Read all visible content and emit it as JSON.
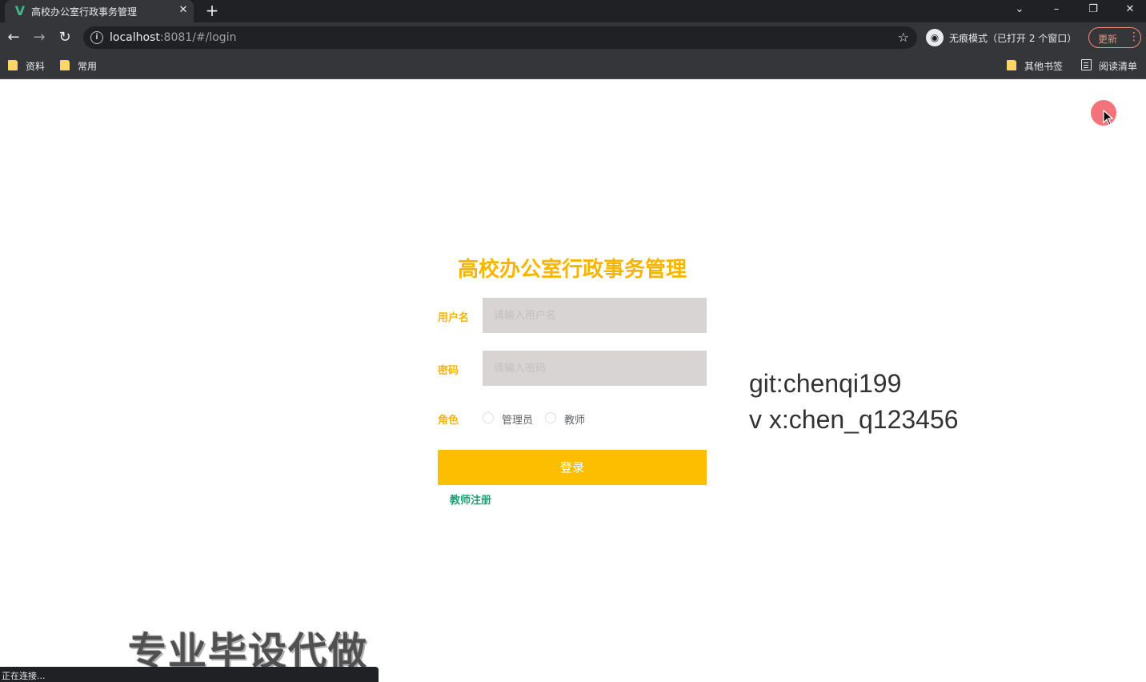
{
  "browser": {
    "tab_title": "高校办公室行政事务管理",
    "tab_favicon": "vue-logo-icon",
    "tab_close": "✕",
    "new_tab": "+",
    "url_host": "localhost",
    "url_rest": ":8081/#/login",
    "incognito_label": "无痕模式（已打开 2 个窗口）",
    "update_label": "更新",
    "bookmarks": [
      {
        "label": "资料",
        "icon": "folder-icon"
      },
      {
        "label": "常用",
        "icon": "folder-icon"
      },
      {
        "label": "其他书签",
        "icon": "folder-icon"
      },
      {
        "label": "阅读清单",
        "icon": "reading-list-icon"
      }
    ],
    "status_text": "正在连接..."
  },
  "login": {
    "title": "高校办公室行政事务管理",
    "username_label": "用户名",
    "username_placeholder": "请输入用户名",
    "password_label": "密码",
    "password_placeholder": "请输入密码",
    "role_label": "角色",
    "roles": [
      "管理员",
      "教师"
    ],
    "submit_label": "登录",
    "register_link": "教师注册"
  },
  "overlay": {
    "line1": "git:chenqi199",
    "line2": "v x:chen_q123456",
    "watermark": "专业毕设代做"
  },
  "colors": {
    "accent": "#f7b500",
    "button": "#fdbe00",
    "link": "#1f9e76",
    "input_bg": "#d9d4d4"
  }
}
